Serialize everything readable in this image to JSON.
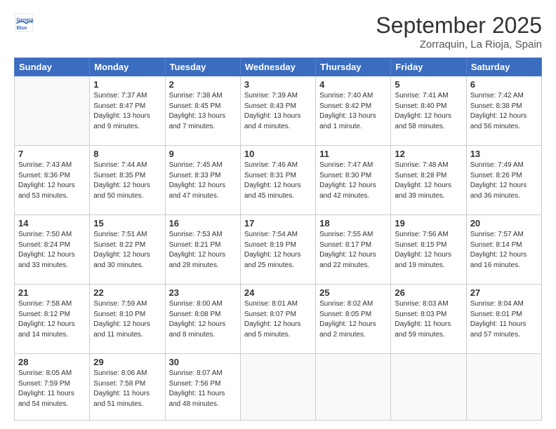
{
  "header": {
    "logo_line1": "General",
    "logo_line2": "Blue",
    "month": "September 2025",
    "location": "Zorraquin, La Rioja, Spain"
  },
  "weekdays": [
    "Sunday",
    "Monday",
    "Tuesday",
    "Wednesday",
    "Thursday",
    "Friday",
    "Saturday"
  ],
  "weeks": [
    [
      {
        "day": "",
        "sunrise": "",
        "sunset": "",
        "daylight": ""
      },
      {
        "day": "1",
        "sunrise": "Sunrise: 7:37 AM",
        "sunset": "Sunset: 8:47 PM",
        "daylight": "Daylight: 13 hours and 9 minutes."
      },
      {
        "day": "2",
        "sunrise": "Sunrise: 7:38 AM",
        "sunset": "Sunset: 8:45 PM",
        "daylight": "Daylight: 13 hours and 7 minutes."
      },
      {
        "day": "3",
        "sunrise": "Sunrise: 7:39 AM",
        "sunset": "Sunset: 8:43 PM",
        "daylight": "Daylight: 13 hours and 4 minutes."
      },
      {
        "day": "4",
        "sunrise": "Sunrise: 7:40 AM",
        "sunset": "Sunset: 8:42 PM",
        "daylight": "Daylight: 13 hours and 1 minute."
      },
      {
        "day": "5",
        "sunrise": "Sunrise: 7:41 AM",
        "sunset": "Sunset: 8:40 PM",
        "daylight": "Daylight: 12 hours and 58 minutes."
      },
      {
        "day": "6",
        "sunrise": "Sunrise: 7:42 AM",
        "sunset": "Sunset: 8:38 PM",
        "daylight": "Daylight: 12 hours and 56 minutes."
      }
    ],
    [
      {
        "day": "7",
        "sunrise": "Sunrise: 7:43 AM",
        "sunset": "Sunset: 8:36 PM",
        "daylight": "Daylight: 12 hours and 53 minutes."
      },
      {
        "day": "8",
        "sunrise": "Sunrise: 7:44 AM",
        "sunset": "Sunset: 8:35 PM",
        "daylight": "Daylight: 12 hours and 50 minutes."
      },
      {
        "day": "9",
        "sunrise": "Sunrise: 7:45 AM",
        "sunset": "Sunset: 8:33 PM",
        "daylight": "Daylight: 12 hours and 47 minutes."
      },
      {
        "day": "10",
        "sunrise": "Sunrise: 7:46 AM",
        "sunset": "Sunset: 8:31 PM",
        "daylight": "Daylight: 12 hours and 45 minutes."
      },
      {
        "day": "11",
        "sunrise": "Sunrise: 7:47 AM",
        "sunset": "Sunset: 8:30 PM",
        "daylight": "Daylight: 12 hours and 42 minutes."
      },
      {
        "day": "12",
        "sunrise": "Sunrise: 7:48 AM",
        "sunset": "Sunset: 8:28 PM",
        "daylight": "Daylight: 12 hours and 39 minutes."
      },
      {
        "day": "13",
        "sunrise": "Sunrise: 7:49 AM",
        "sunset": "Sunset: 8:26 PM",
        "daylight": "Daylight: 12 hours and 36 minutes."
      }
    ],
    [
      {
        "day": "14",
        "sunrise": "Sunrise: 7:50 AM",
        "sunset": "Sunset: 8:24 PM",
        "daylight": "Daylight: 12 hours and 33 minutes."
      },
      {
        "day": "15",
        "sunrise": "Sunrise: 7:51 AM",
        "sunset": "Sunset: 8:22 PM",
        "daylight": "Daylight: 12 hours and 30 minutes."
      },
      {
        "day": "16",
        "sunrise": "Sunrise: 7:53 AM",
        "sunset": "Sunset: 8:21 PM",
        "daylight": "Daylight: 12 hours and 28 minutes."
      },
      {
        "day": "17",
        "sunrise": "Sunrise: 7:54 AM",
        "sunset": "Sunset: 8:19 PM",
        "daylight": "Daylight: 12 hours and 25 minutes."
      },
      {
        "day": "18",
        "sunrise": "Sunrise: 7:55 AM",
        "sunset": "Sunset: 8:17 PM",
        "daylight": "Daylight: 12 hours and 22 minutes."
      },
      {
        "day": "19",
        "sunrise": "Sunrise: 7:56 AM",
        "sunset": "Sunset: 8:15 PM",
        "daylight": "Daylight: 12 hours and 19 minutes."
      },
      {
        "day": "20",
        "sunrise": "Sunrise: 7:57 AM",
        "sunset": "Sunset: 8:14 PM",
        "daylight": "Daylight: 12 hours and 16 minutes."
      }
    ],
    [
      {
        "day": "21",
        "sunrise": "Sunrise: 7:58 AM",
        "sunset": "Sunset: 8:12 PM",
        "daylight": "Daylight: 12 hours and 14 minutes."
      },
      {
        "day": "22",
        "sunrise": "Sunrise: 7:59 AM",
        "sunset": "Sunset: 8:10 PM",
        "daylight": "Daylight: 12 hours and 11 minutes."
      },
      {
        "day": "23",
        "sunrise": "Sunrise: 8:00 AM",
        "sunset": "Sunset: 8:08 PM",
        "daylight": "Daylight: 12 hours and 8 minutes."
      },
      {
        "day": "24",
        "sunrise": "Sunrise: 8:01 AM",
        "sunset": "Sunset: 8:07 PM",
        "daylight": "Daylight: 12 hours and 5 minutes."
      },
      {
        "day": "25",
        "sunrise": "Sunrise: 8:02 AM",
        "sunset": "Sunset: 8:05 PM",
        "daylight": "Daylight: 12 hours and 2 minutes."
      },
      {
        "day": "26",
        "sunrise": "Sunrise: 8:03 AM",
        "sunset": "Sunset: 8:03 PM",
        "daylight": "Daylight: 11 hours and 59 minutes."
      },
      {
        "day": "27",
        "sunrise": "Sunrise: 8:04 AM",
        "sunset": "Sunset: 8:01 PM",
        "daylight": "Daylight: 11 hours and 57 minutes."
      }
    ],
    [
      {
        "day": "28",
        "sunrise": "Sunrise: 8:05 AM",
        "sunset": "Sunset: 7:59 PM",
        "daylight": "Daylight: 11 hours and 54 minutes."
      },
      {
        "day": "29",
        "sunrise": "Sunrise: 8:06 AM",
        "sunset": "Sunset: 7:58 PM",
        "daylight": "Daylight: 11 hours and 51 minutes."
      },
      {
        "day": "30",
        "sunrise": "Sunrise: 8:07 AM",
        "sunset": "Sunset: 7:56 PM",
        "daylight": "Daylight: 11 hours and 48 minutes."
      },
      {
        "day": "",
        "sunrise": "",
        "sunset": "",
        "daylight": ""
      },
      {
        "day": "",
        "sunrise": "",
        "sunset": "",
        "daylight": ""
      },
      {
        "day": "",
        "sunrise": "",
        "sunset": "",
        "daylight": ""
      },
      {
        "day": "",
        "sunrise": "",
        "sunset": "",
        "daylight": ""
      }
    ]
  ]
}
